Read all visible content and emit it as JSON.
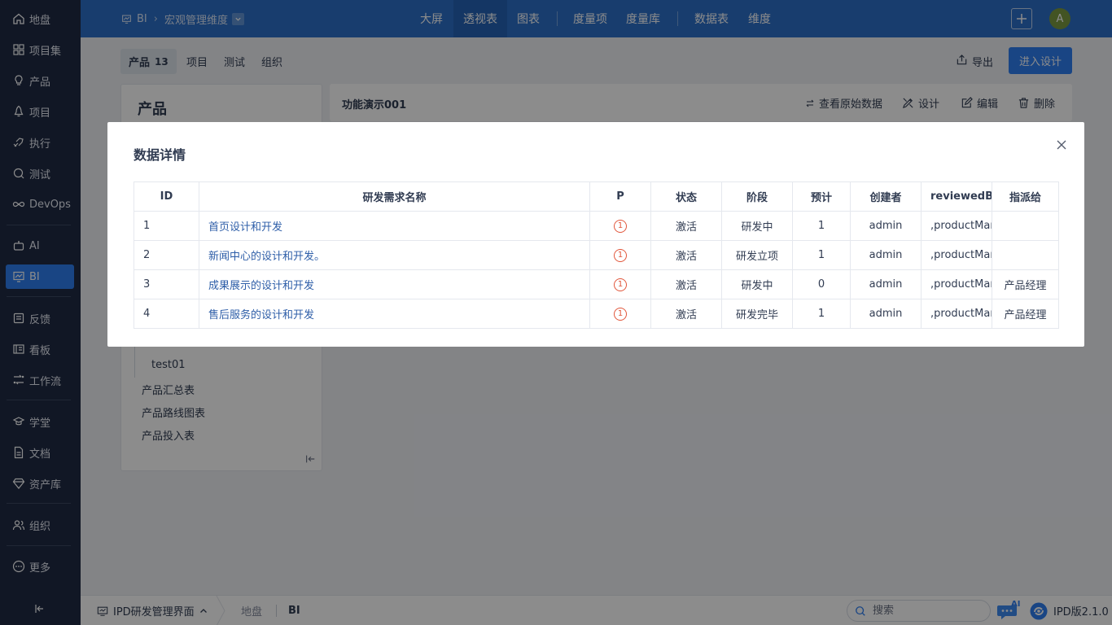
{
  "sidebar": {
    "items": [
      {
        "label": "地盘",
        "icon": "home-icon"
      },
      {
        "label": "项目集",
        "icon": "grid-icon"
      },
      {
        "label": "产品",
        "icon": "lightbulb-icon"
      },
      {
        "label": "项目",
        "icon": "rocket-icon"
      },
      {
        "label": "执行",
        "icon": "run-icon"
      },
      {
        "label": "测试",
        "icon": "test-icon"
      },
      {
        "label": "DevOps",
        "icon": "infinity-icon"
      },
      {
        "label": "AI",
        "icon": "robot-icon"
      },
      {
        "label": "BI",
        "icon": "chart-icon",
        "active": true
      },
      {
        "label": "反馈",
        "icon": "feedback-icon"
      },
      {
        "label": "看板",
        "icon": "kanban-icon"
      },
      {
        "label": "工作流",
        "icon": "workflow-icon"
      },
      {
        "label": "学堂",
        "icon": "school-icon"
      },
      {
        "label": "文档",
        "icon": "doc-icon"
      },
      {
        "label": "资产库",
        "icon": "diamond-icon"
      },
      {
        "label": "组织",
        "icon": "people-icon"
      },
      {
        "label": "更多",
        "icon": "more-icon"
      }
    ]
  },
  "topbar": {
    "breadcrumb_root": "BI",
    "breadcrumb_current": "宏观管理维度",
    "nav": [
      "大屏",
      "透视表",
      "图表",
      "度量项",
      "度量库",
      "数据表",
      "维度"
    ],
    "active_nav": "透视表",
    "avatar_letter": "A",
    "brand_color": "#2d70c9"
  },
  "subtabs": {
    "items": [
      "产品",
      "项目",
      "测试",
      "组织"
    ],
    "product_count": "13",
    "export_label": "导出",
    "design_button": "进入设计"
  },
  "left_panel": {
    "title": "产品",
    "tree_items": [
      "test01",
      "产品汇总表",
      "产品路线图表",
      "产品投入表"
    ]
  },
  "right_panel": {
    "title": "功能演示001",
    "actions": [
      "查看原始数据",
      "设计",
      "编辑",
      "删除"
    ]
  },
  "modal": {
    "title": "数据详情",
    "columns": [
      "ID",
      "研发需求名称",
      "P",
      "状态",
      "阶段",
      "预计",
      "创建者",
      "reviewedBy",
      "指派给"
    ],
    "rows": [
      {
        "id": "1",
        "name": "首页设计和开发",
        "p": "1",
        "status": "激活",
        "stage": "研发中",
        "estimate": "1",
        "creator": "admin",
        "reviewed": ",productMan",
        "assigned": ""
      },
      {
        "id": "2",
        "name": "新闻中心的设计和开发。",
        "p": "1",
        "status": "激活",
        "stage": "研发立项",
        "estimate": "1",
        "creator": "admin",
        "reviewed": ",productMan",
        "assigned": ""
      },
      {
        "id": "3",
        "name": "成果展示的设计和开发",
        "p": "1",
        "status": "激活",
        "stage": "研发中",
        "estimate": "0",
        "creator": "admin",
        "reviewed": ",productMan",
        "assigned": "产品经理"
      },
      {
        "id": "4",
        "name": "售后服务的设计和开发",
        "p": "1",
        "status": "激活",
        "stage": "研发完毕",
        "estimate": "1",
        "creator": "admin",
        "reviewed": ",productMan",
        "assigned": "产品经理"
      }
    ]
  },
  "bottombar": {
    "app_name": "IPD研发管理界面",
    "links": [
      "地盘",
      "BI"
    ],
    "search_placeholder": "搜索",
    "ai_label": "AI",
    "version": "IPD版2.1.0"
  }
}
